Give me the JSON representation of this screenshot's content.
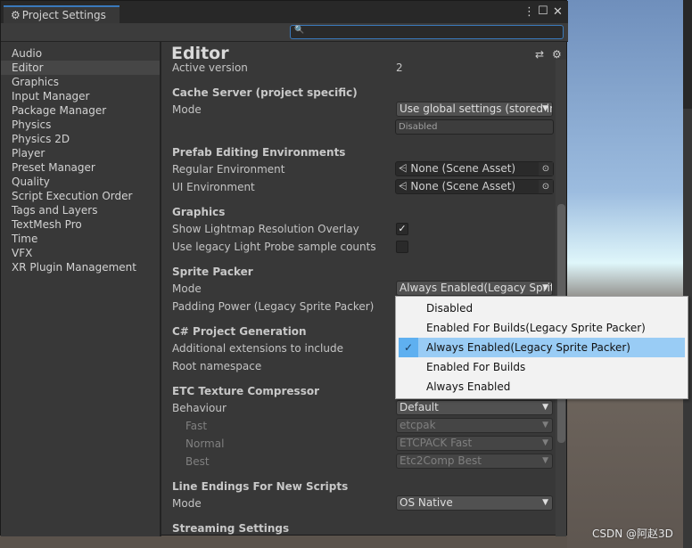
{
  "window": {
    "title": "Project Settings",
    "tab_icon": "gear-icon",
    "controls": [
      "more-icon",
      "maximize-icon",
      "close-icon"
    ]
  },
  "search": {
    "placeholder": "",
    "value": ""
  },
  "sidebar": {
    "selected": "Editor",
    "items": [
      "Audio",
      "Editor",
      "Graphics",
      "Input Manager",
      "Package Manager",
      "Physics",
      "Physics 2D",
      "Player",
      "Preset Manager",
      "Quality",
      "Script Execution Order",
      "Tags and Layers",
      "TextMesh Pro",
      "Time",
      "VFX",
      "XR Plugin Management"
    ]
  },
  "main": {
    "title": "Editor",
    "active_version_label": "Active version",
    "active_version": "2",
    "cache_server": {
      "header": "Cache Server (project specific)",
      "mode_label": "Mode",
      "mode": "Use global settings (stored in",
      "status": "Disabled"
    },
    "prefab": {
      "header": "Prefab Editing Environments",
      "regular_label": "Regular Environment",
      "regular": "None (Scene Asset)",
      "ui_label": "UI Environment",
      "ui": "None (Scene Asset)"
    },
    "graphics": {
      "header": "Graphics",
      "overlay_label": "Show Lightmap Resolution Overlay",
      "overlay": true,
      "legacy_label": "Use legacy Light Probe sample counts",
      "legacy": false
    },
    "sprite_packer": {
      "header": "Sprite Packer",
      "mode_label": "Mode",
      "mode": "Always Enabled(Legacy Sprite Packer)",
      "padding_label": "Padding Power (Legacy Sprite Packer)"
    },
    "csharp": {
      "header": "C# Project Generation",
      "ext_label": "Additional extensions to include",
      "ns_label": "Root namespace"
    },
    "etc": {
      "header": "ETC Texture Compressor",
      "behaviour_label": "Behaviour",
      "behaviour": "Default",
      "fast_label": "Fast",
      "fast": "etcpak",
      "normal_label": "Normal",
      "normal": "ETCPACK Fast",
      "best_label": "Best",
      "best": "Etc2Comp Best"
    },
    "line_endings": {
      "header": "Line Endings For New Scripts",
      "mode_label": "Mode",
      "mode": "OS Native"
    },
    "streaming": {
      "header": "Streaming Settings"
    }
  },
  "dropdown_menu": {
    "selected_index": 2,
    "items": [
      "Disabled",
      "Enabled For Builds(Legacy Sprite Packer)",
      "Always Enabled(Legacy Sprite Packer)",
      "Enabled For Builds",
      "Always Enabled"
    ]
  },
  "watermark": "CSDN @阿赵3D"
}
